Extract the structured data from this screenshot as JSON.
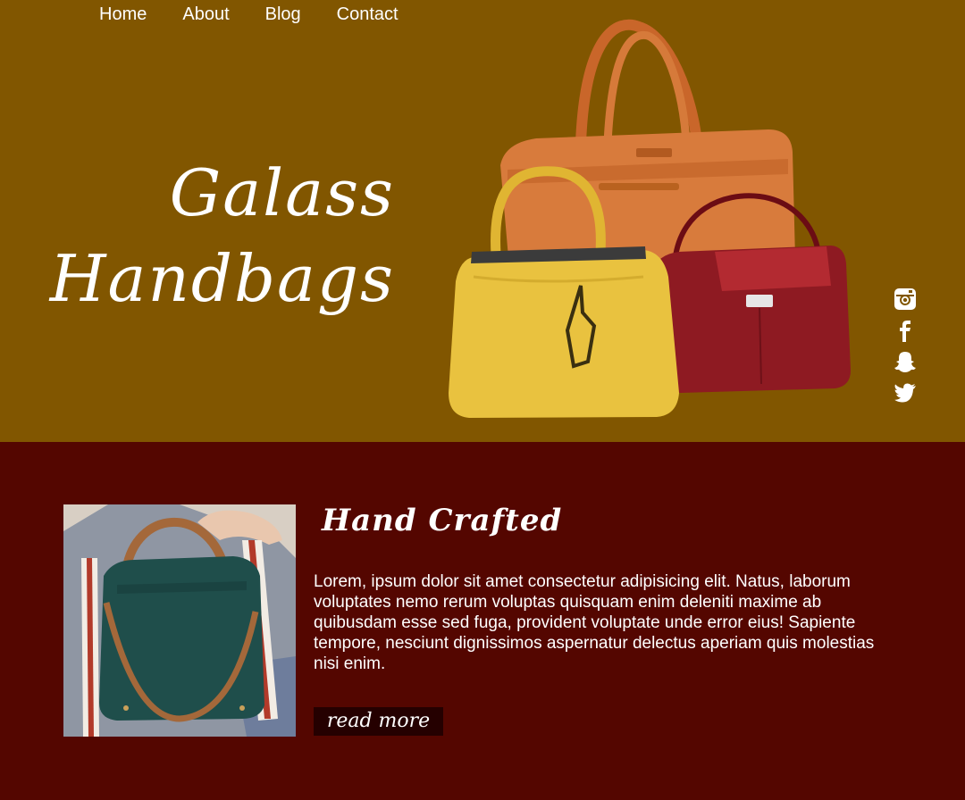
{
  "nav": {
    "items": [
      {
        "label": "Home"
      },
      {
        "label": "About"
      },
      {
        "label": "Blog"
      },
      {
        "label": "Contact"
      }
    ]
  },
  "hero": {
    "title_line1": "Galass",
    "title_line2": "Handbags",
    "background": "#815600"
  },
  "social": {
    "icons": [
      "instagram-icon",
      "facebook-icon",
      "snapchat-icon",
      "twitter-icon"
    ]
  },
  "section": {
    "title": "Hand Crafted",
    "body": "Lorem, ipsum dolor sit amet consectetur adipisicing elit. Natus, laborum voluptates nemo rerum voluptas quisquam enim deleniti maxime ab quibusdam esse sed fuga, provident voluptate unde error eius! Sapiente tempore, nesciunt dignissimos aspernatur delectus aperiam quis molestias nisi enim.",
    "button_label": "read more",
    "background": "#540600",
    "button_color": "#250000"
  }
}
